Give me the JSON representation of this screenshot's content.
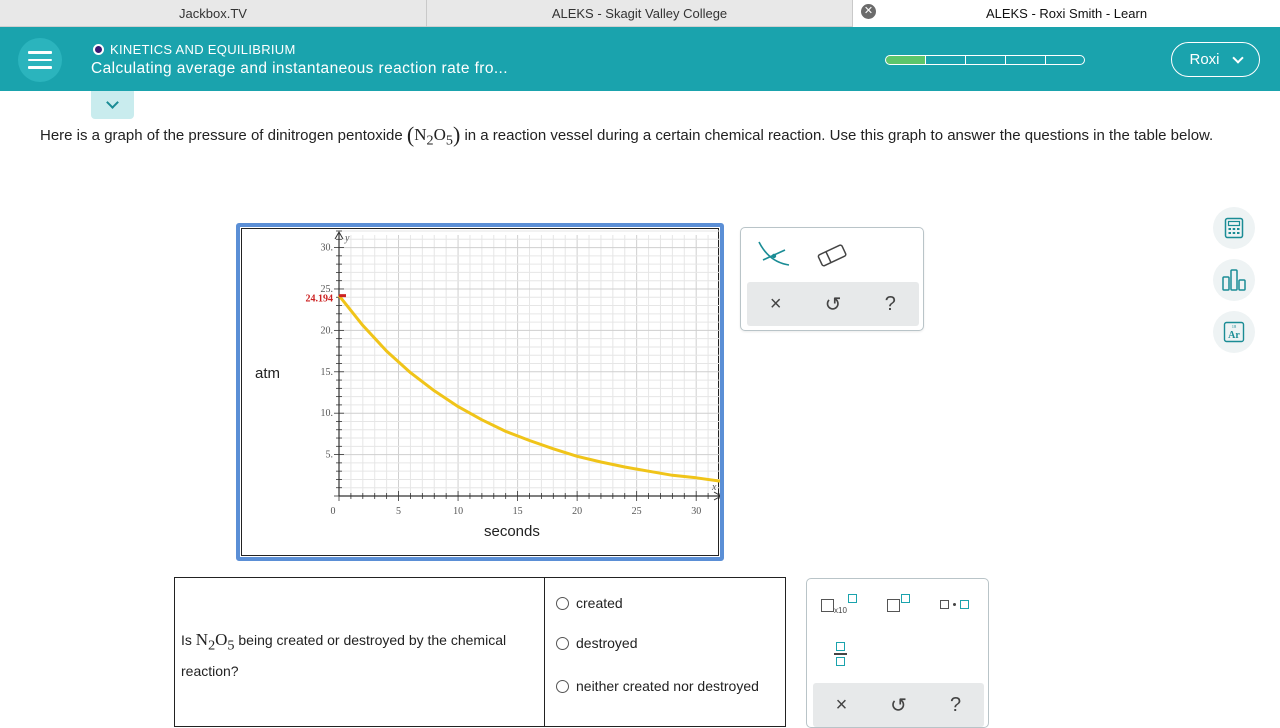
{
  "browser": {
    "tabs": [
      {
        "label": "Jackbox.TV"
      },
      {
        "label": "ALEKS - Skagit Valley College"
      },
      {
        "label": "ALEKS - Roxi Smith - Learn",
        "active": true
      }
    ]
  },
  "header": {
    "topic": "KINETICS AND EQUILIBRIUM",
    "lesson_title": "Calculating average and instantaneous reaction rate fro...",
    "progress": {
      "segments": 5,
      "filled": 1
    },
    "user_name": "Roxi",
    "colors": {
      "bar": "#1aa3ad",
      "progress_fill": "#5cc66b",
      "topic_dot": "#3a1a73"
    }
  },
  "question": {
    "intro_part1": "Here is a graph of the pressure of dinitrogen pentoxide",
    "formula": {
      "el1": "N",
      "sub1": "2",
      "el2": "O",
      "sub2": "5"
    },
    "intro_part2": "in a reaction vessel during a certain chemical reaction. Use this graph to answer the questions in the table below."
  },
  "chart_data": {
    "type": "line",
    "xlabel": "seconds",
    "ylabel": "atm",
    "x_axis_letter": "x",
    "y_axis_letter": "y",
    "xlim": [
      0,
      32
    ],
    "ylim": [
      0,
      32
    ],
    "x_ticks": [
      0,
      5,
      10,
      15,
      20,
      25,
      30
    ],
    "y_ticks": [
      5,
      10,
      15,
      20,
      25,
      30
    ],
    "x_tick_labels": [
      "0",
      "5",
      "10",
      "15",
      "20",
      "25",
      "30"
    ],
    "y_tick_labels": [
      "5.",
      "10.",
      "15.",
      "20.",
      "25.",
      "30."
    ],
    "grid": true,
    "highlight": {
      "y": 24.194,
      "label": "24.194",
      "color": "#cc2222"
    },
    "series": [
      {
        "color": "#f0c419",
        "x": [
          0,
          2,
          4,
          6,
          8,
          10,
          12,
          14,
          16,
          18,
          20,
          22,
          24,
          26,
          28,
          30,
          32
        ],
        "y": [
          24.194,
          20.6,
          17.5,
          14.9,
          12.7,
          10.8,
          9.2,
          7.8,
          6.7,
          5.7,
          4.8,
          4.1,
          3.5,
          3.0,
          2.5,
          2.2,
          1.8
        ]
      }
    ]
  },
  "graph_tools": {
    "close": "×",
    "undo": "↺",
    "help": "?"
  },
  "table": {
    "q1": {
      "prefix": "Is",
      "formula": {
        "el1": "N",
        "sub1": "2",
        "el2": "O",
        "sub2": "5"
      },
      "suffix": "being created or destroyed by the chemical reaction?"
    },
    "options": [
      "created",
      "destroyed",
      "neither created nor destroyed"
    ]
  },
  "math_palette": {
    "x10_label": "x10",
    "close": "×",
    "undo": "↺",
    "help": "?"
  }
}
